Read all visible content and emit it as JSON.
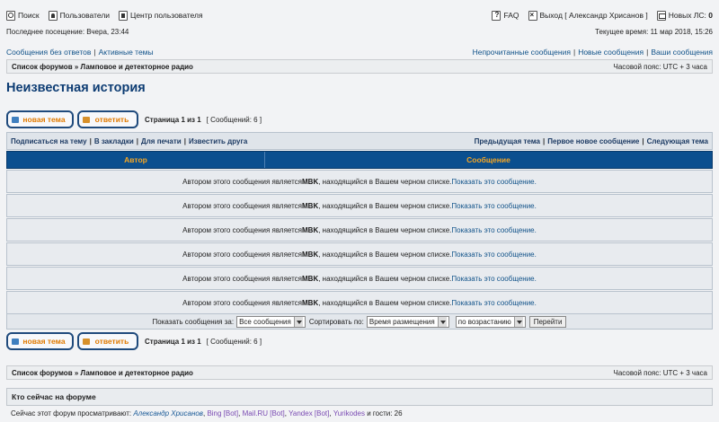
{
  "nav": {
    "search": "Поиск",
    "members": "Пользователи",
    "ucp": "Центр пользователя",
    "faq": "FAQ",
    "logout": "Выход [ Александр Хрисанов ]",
    "pm_label": "Новых ЛС:",
    "pm_count": "0"
  },
  "visit": {
    "last": "Последнее посещение: Вчера, 23:44",
    "current": "Текущее время: 11 мар 2018, 15:26"
  },
  "quick": {
    "unanswered": "Сообщения без ответов",
    "active": "Активные темы",
    "unread": "Непрочитанные сообщения",
    "new": "Новые сообщения",
    "your": "Ваши сообщения"
  },
  "breadcrumb": {
    "index": "Список форумов",
    "arrow": "»",
    "forum": "Ламповое и детекторное радио",
    "timezone": "Часовой пояс: UTC + 3 часа"
  },
  "topic_title": "Неизвестная история",
  "buttons": {
    "new_topic": "новая тема",
    "reply": "ответить"
  },
  "pagination": {
    "page": "Страница 1 из 1",
    "posts": "[ Сообщений: 6 ]"
  },
  "actions": {
    "subscribe": "Подписаться на тему",
    "bookmark": "В закладки",
    "print": "Для печати",
    "email": "Известить друга",
    "prev": "Предыдущая тема",
    "first_new": "Первое новое сообщение",
    "next": "Следующая тема"
  },
  "table": {
    "col_author": "Автор",
    "col_message": "Сообщение"
  },
  "posts": [
    {
      "pre": "Автором этого сообщения является ",
      "user": "MBK",
      "post": ", находящийся в Вашем черном списке. ",
      "show": "Показать это сообщение."
    },
    {
      "pre": "Автором этого сообщения является ",
      "user": "MBK",
      "post": ", находящийся в Вашем черном списке. ",
      "show": "Показать это сообщение."
    },
    {
      "pre": "Автором этого сообщения является ",
      "user": "MBK",
      "post": ", находящийся в Вашем черном списке. ",
      "show": "Показать это сообщение."
    },
    {
      "pre": "Автором этого сообщения является ",
      "user": "MBK",
      "post": ", находящийся в Вашем черном списке. ",
      "show": "Показать это сообщение."
    },
    {
      "pre": "Автором этого сообщения является ",
      "user": "MBK",
      "post": ", находящийся в Вашем черном списке. ",
      "show": "Показать это сообщение."
    },
    {
      "pre": "Автором этого сообщения является ",
      "user": "MBK",
      "post": ", находящийся в Вашем черном списке. ",
      "show": "Показать это сообщение."
    }
  ],
  "sort": {
    "show_label": "Показать сообщения за:",
    "show_value": "Все сообщения",
    "sort_label": "Сортировать по:",
    "sort_value": "Время размещения",
    "dir_value": "по возрастанию",
    "go": "Перейти"
  },
  "online": {
    "heading": "Кто сейчас на форуме",
    "prefix": "Сейчас этот форум просматривают:",
    "users": [
      "Александр Хрисанов",
      "Bing [Bot]",
      "Mail.RU [Bot]",
      "Yandex [Bot]",
      "Yurikodes"
    ],
    "suffix": "и гости: 26"
  }
}
